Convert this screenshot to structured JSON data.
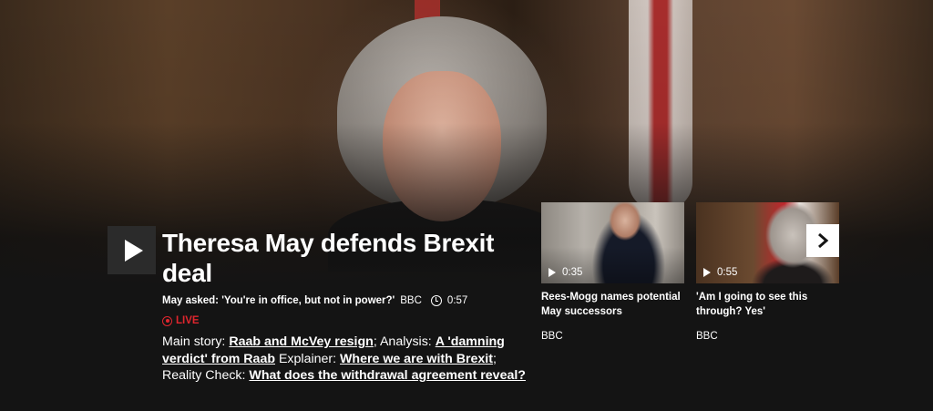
{
  "main": {
    "headline": "Theresa May defends Brexit deal",
    "subtitle": "May asked: 'You're in office, but not in power?'",
    "source": "BBC",
    "duration": "0:57",
    "live_label": "LIVE",
    "related": {
      "main_story_label": "Main story:",
      "main_story_link": "Raab and McVey resign",
      "sep1": ";",
      "analysis_label": "Analysis:",
      "analysis_link": "A 'damning verdict' from Raab",
      "explainer_label": "Explainer:",
      "explainer_link": "Where we are with Brexit",
      "sep2": ";",
      "reality_label": "Reality Check:",
      "reality_link": "What does the withdrawal agreement reveal?"
    }
  },
  "cards": [
    {
      "duration": "0:35",
      "title": "Rees-Mogg names potential May successors",
      "source": "BBC"
    },
    {
      "duration": "0:55",
      "title": "'Am I going to see this through? Yes'",
      "source": "BBC"
    }
  ],
  "icons": {
    "play": "play-icon",
    "clock": "clock-icon",
    "live": "live-icon",
    "next": "chevron-right-icon"
  },
  "colors": {
    "background": "#141414",
    "live": "#e0262e",
    "text": "#ffffff"
  }
}
